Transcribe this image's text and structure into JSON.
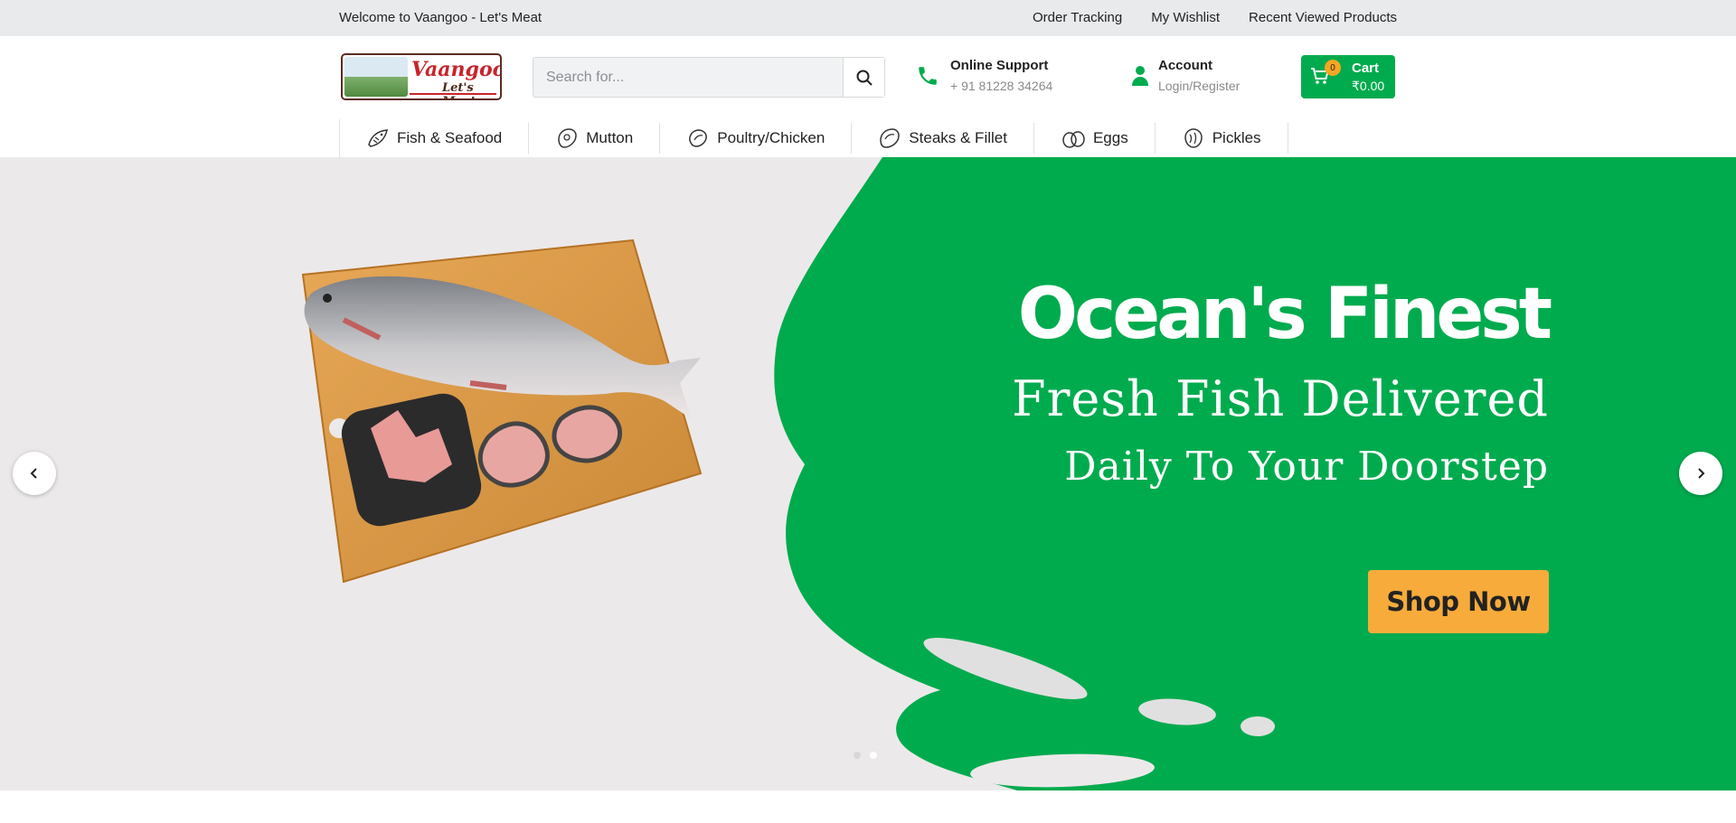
{
  "topbar": {
    "welcome": "Welcome to Vaangoo - Let's Meat",
    "links": [
      "Order Tracking",
      "My Wishlist",
      "Recent Viewed Products"
    ]
  },
  "logo": {
    "brand": "Vaangoo",
    "tagline": "Let's Meat"
  },
  "search": {
    "placeholder": "Search for..."
  },
  "support": {
    "title": "Online Support",
    "phone": "+ 91 81228 34264"
  },
  "account": {
    "title": "Account",
    "sub": "Login/Register"
  },
  "cart": {
    "label": "Cart",
    "count": "0",
    "amount": "₹0.00"
  },
  "nav": [
    {
      "label": "Fish & Seafood",
      "icon": "fish-icon"
    },
    {
      "label": "Mutton",
      "icon": "mutton-icon"
    },
    {
      "label": "Poultry/Chicken",
      "icon": "chicken-icon"
    },
    {
      "label": "Steaks & Fillet",
      "icon": "steak-icon"
    },
    {
      "label": "Eggs",
      "icon": "eggs-icon"
    },
    {
      "label": "Pickles",
      "icon": "pickles-icon"
    }
  ],
  "hero": {
    "headline": "Ocean's Finest",
    "line1": "Fresh Fish Delivered",
    "line2": "Daily To Your Doorstep",
    "cta": "Shop Now",
    "slides": 2,
    "active_slide": 2
  },
  "colors": {
    "brand_green": "#00ab4e",
    "cta_orange": "#f7ab3b",
    "logo_red": "#c8242b"
  }
}
